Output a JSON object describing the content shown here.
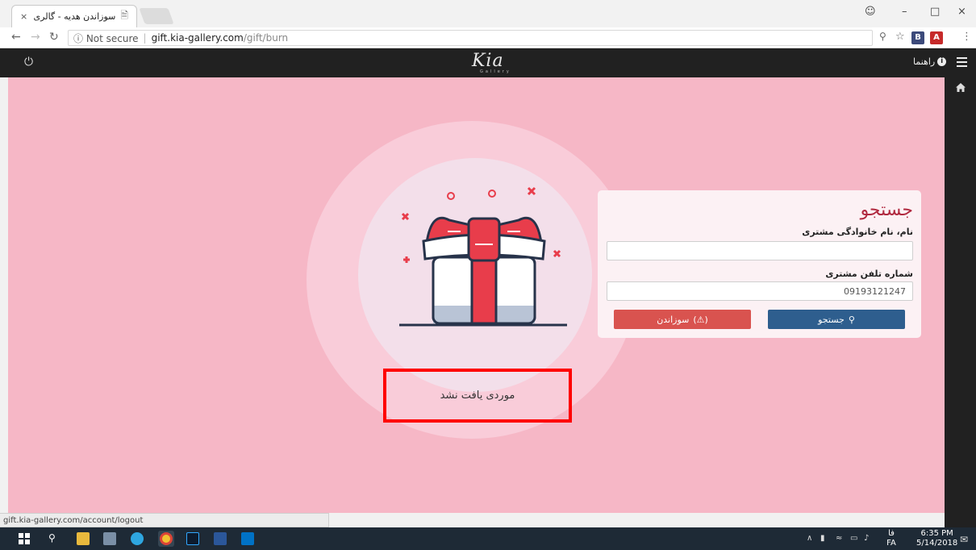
{
  "browser": {
    "tab_title": "سوزاندن هدیه - گالری کیا",
    "tab_close": "×",
    "url_security": "ⓘ Not secure",
    "url_separator": "|",
    "url_host": "gift.kia-gallery.com",
    "url_path": "/gift/burn",
    "ext_b_label": "B",
    "ext_pdf_label": "A"
  },
  "header": {
    "logo": "Kia",
    "logo_sub": "Gallery",
    "help_label": "راهنما"
  },
  "search_card": {
    "title": "جستجو",
    "name_label": "نام، نام خانوادگی مشتری",
    "name_value": "",
    "phone_label": "شماره تلفن مشتری",
    "phone_value": "09193121247",
    "search_button": "جستجو",
    "burn_button": "سوزاندن"
  },
  "result": {
    "message": "موردی یافت نشد"
  },
  "status": {
    "hover_url": "gift.kia-gallery.com/account/logout"
  },
  "taskbar": {
    "lang_top": "فا",
    "lang_bottom": "FA",
    "time": "6:35 PM",
    "date": "5/14/2018"
  },
  "colors": {
    "page_bg": "#f6b7c6",
    "header_bg": "#212121",
    "search_button": "#2e5e8e",
    "burn_button": "#d9534f",
    "highlight_border": "#ff0000"
  }
}
